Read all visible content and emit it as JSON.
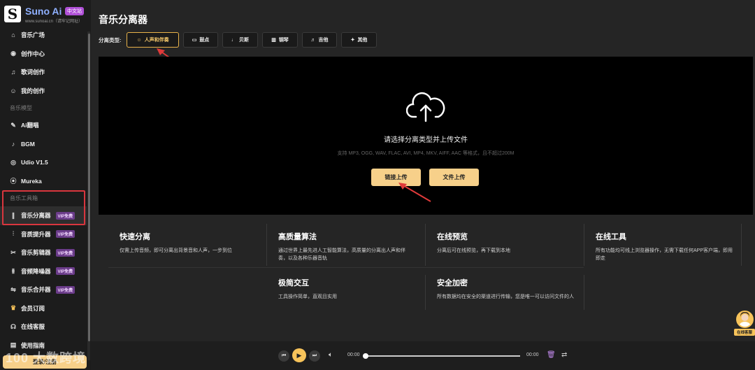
{
  "brand": {
    "name": "Suno Ai",
    "badge": "中文站",
    "sub": "www.sunoai.cn（请牢记网址）",
    "logo_letter": "S"
  },
  "sidebar": {
    "items_top": [
      {
        "label": "音乐广场",
        "icon": "home-icon"
      },
      {
        "label": "创作中心",
        "icon": "music-disc-icon"
      },
      {
        "label": "歌词创作",
        "icon": "note-icon"
      },
      {
        "label": "我的创作",
        "icon": "user-icon"
      }
    ],
    "section_models": "音乐模型",
    "items_models": [
      {
        "label": "Ai翻唱",
        "icon": "mic-icon"
      },
      {
        "label": "BGM",
        "icon": "note-icon"
      },
      {
        "label": "Udio V1.5",
        "icon": "disc-icon"
      },
      {
        "label": "Mureka",
        "icon": "target-icon"
      }
    ],
    "section_tools": "音乐工具箱",
    "items_tools": [
      {
        "label": "音乐分离器",
        "icon": "waveform-icon",
        "vip": "VIP免费"
      },
      {
        "label": "音质提升器",
        "icon": "equalizer-icon",
        "vip": "VIP免费"
      },
      {
        "label": "音乐剪辑器",
        "icon": "scissors-icon",
        "vip": "VIP免费"
      },
      {
        "label": "音频降噪器",
        "icon": "sliders-icon",
        "vip": "VIP免费"
      },
      {
        "label": "音乐合并器",
        "icon": "merge-icon",
        "vip": "VIP免费"
      }
    ],
    "items_bottom": [
      {
        "label": "会员订阅",
        "icon": "crown-icon"
      },
      {
        "label": "在线客服",
        "icon": "headset-icon"
      },
      {
        "label": "使用指南",
        "icon": "book-icon"
      }
    ],
    "login_label": "登录/注册",
    "watermark": "100 大数跨境"
  },
  "main": {
    "title": "音乐分离器",
    "type_label": "分离类型:",
    "types": [
      {
        "label": "人声和伴奏",
        "icon": "vocal-icon"
      },
      {
        "label": "鼓点",
        "icon": "drum-icon"
      },
      {
        "label": "贝斯",
        "icon": "bass-icon"
      },
      {
        "label": "钢琴",
        "icon": "piano-icon"
      },
      {
        "label": "吉他",
        "icon": "guitar-icon"
      },
      {
        "label": "其他",
        "icon": "other-icon"
      }
    ],
    "upload": {
      "title": "请选择分离类型并上传文件",
      "hint": "支持 MP3, OGG, WAV, FLAC, AVI, MP4, MKV, AIFF, AAC 等格式，且不超过200M",
      "link_label": "链接上传",
      "file_label": "文件上传"
    },
    "features": [
      {
        "title": "快速分离",
        "desc": "仅需上传音频，即可分离出背景音和人声，一步到位"
      },
      {
        "title": "高质量算法",
        "desc": "通过世界上最先进人工智能算法，高质量的分离出人声和伴奏，以及各种乐器音轨"
      },
      {
        "title": "在线预览",
        "desc": "分离后可在线预览，再下载到本地"
      },
      {
        "title": "在线工具",
        "desc": "所有功能均可线上浏览器操作，无需下载任何APP客户端，即用即走"
      },
      {
        "title": "极简交互",
        "desc": "工具操作简单，直观且实用"
      },
      {
        "title": "安全加密",
        "desc": "所有数据均在安全的渠道进行传输，您是唯一可以访问文件的人"
      }
    ]
  },
  "player": {
    "current_time": "00:00",
    "total_time": "00:00",
    "progress": 0
  },
  "service": {
    "label": "在线客服"
  },
  "colors": {
    "accent": "#f7c35a",
    "highlight_box": "#d9363e",
    "annotation_arrow": "#e03a3a"
  }
}
